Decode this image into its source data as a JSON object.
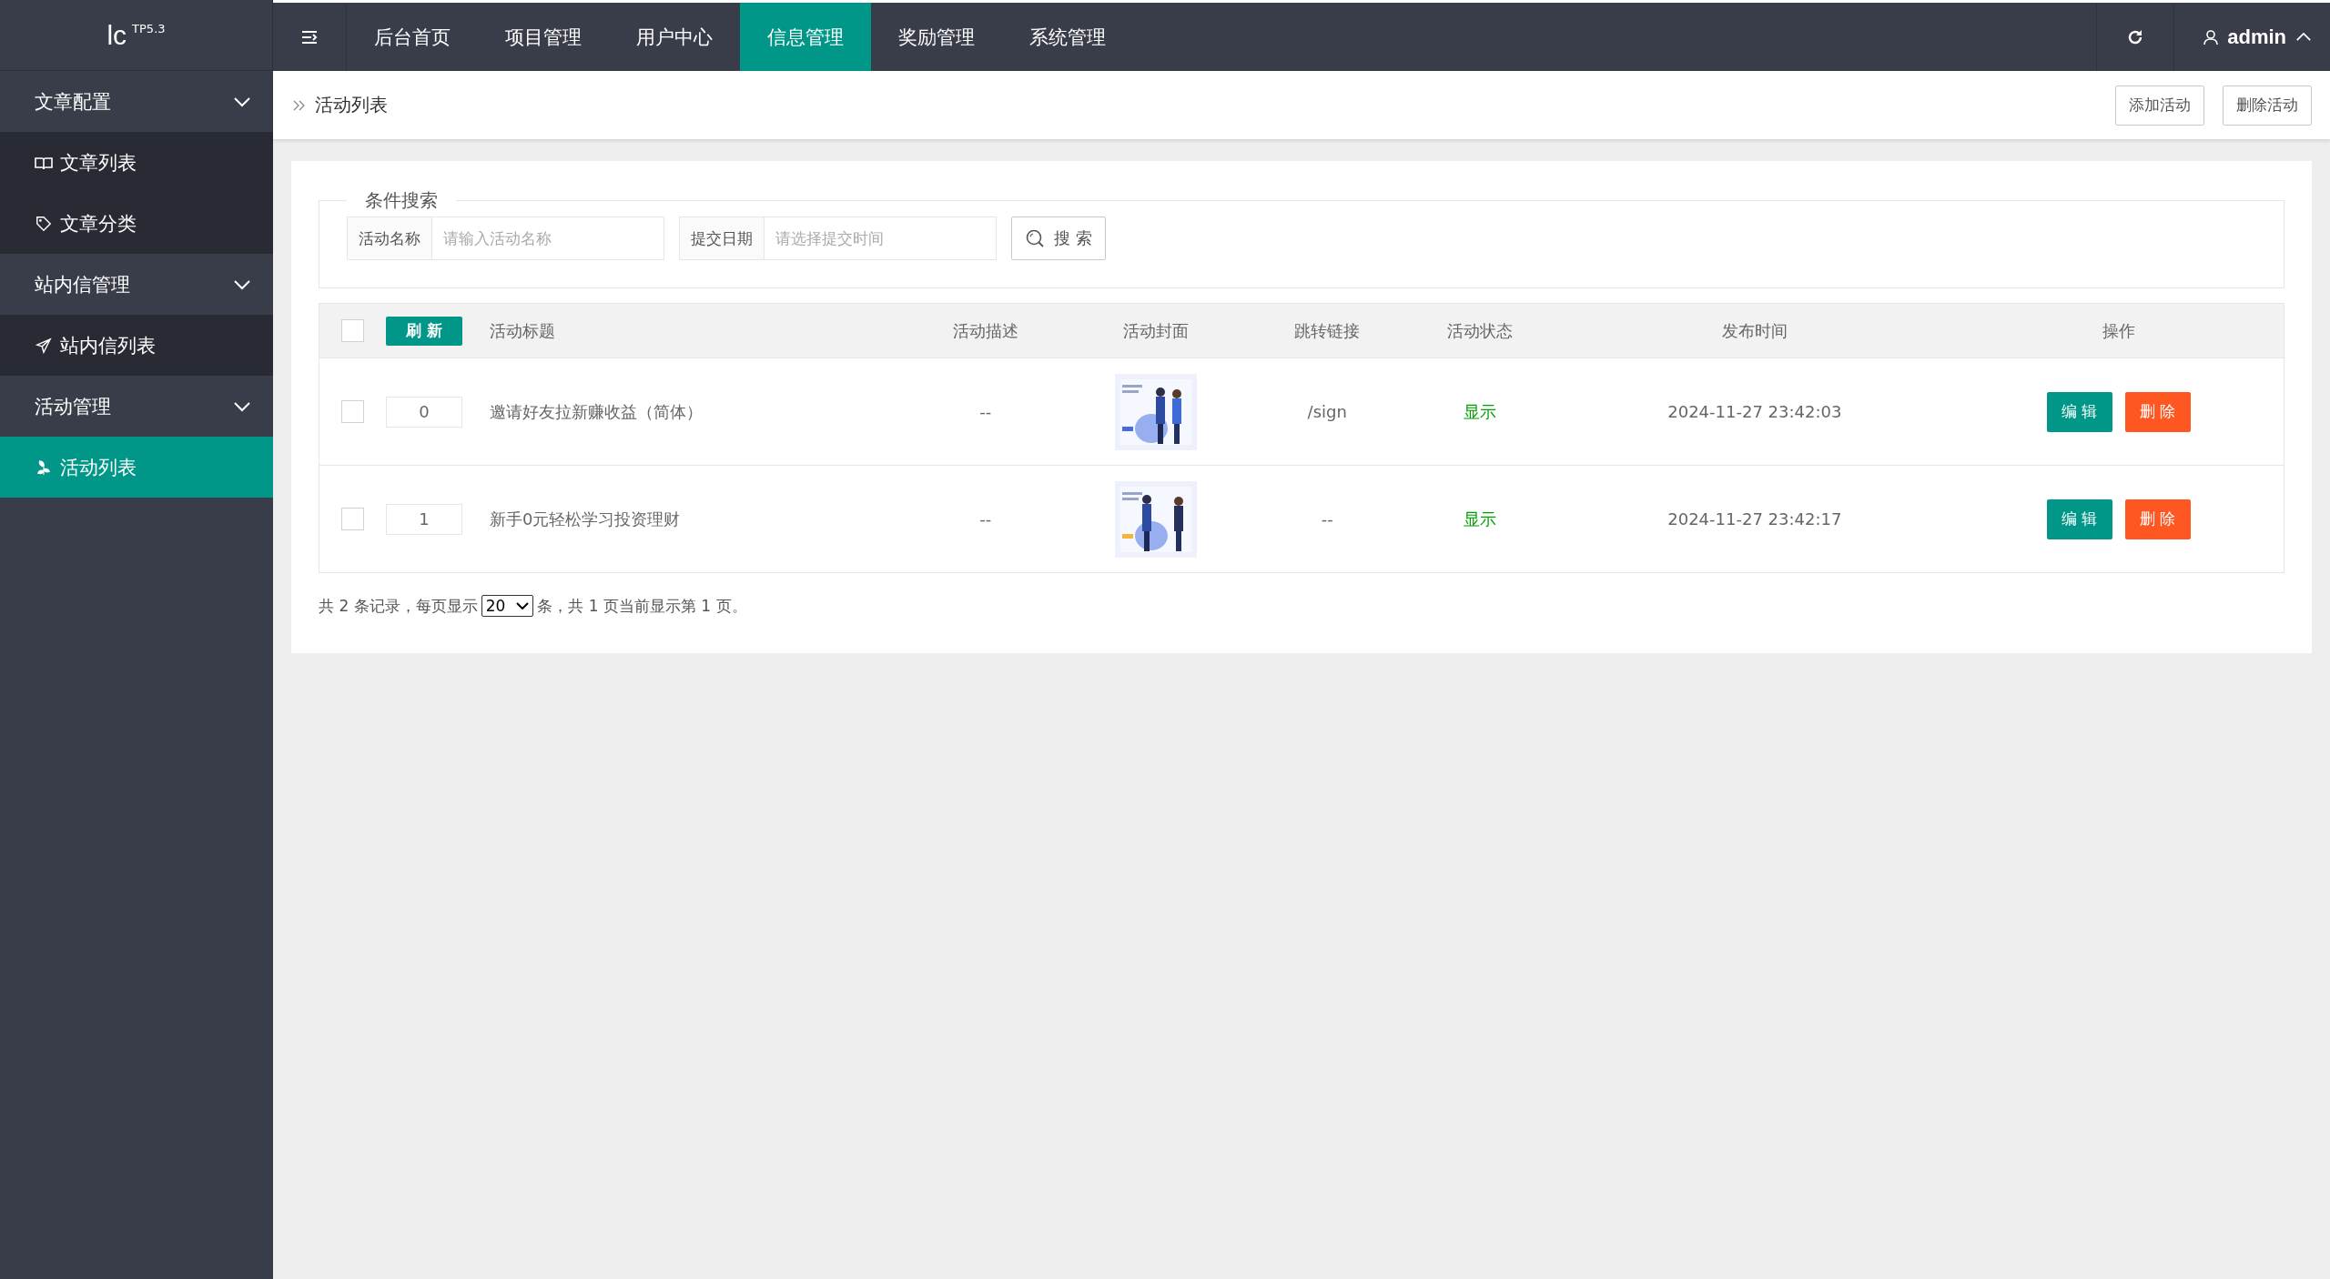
{
  "logo": {
    "text": "lc",
    "version": "TP5.3"
  },
  "top_nav": [
    {
      "label": "后台首页",
      "selected": false
    },
    {
      "label": "项目管理",
      "selected": false
    },
    {
      "label": "用户中心",
      "selected": false
    },
    {
      "label": "信息管理",
      "selected": true
    },
    {
      "label": "奖励管理",
      "selected": false
    },
    {
      "label": "系统管理",
      "selected": false
    }
  ],
  "user": {
    "name": "admin",
    "expanded": true
  },
  "sidebar": [
    {
      "label": "文章配置",
      "expanded": true,
      "children": [
        {
          "label": "文章列表",
          "selected": false
        },
        {
          "label": "文章分类",
          "selected": false
        }
      ]
    },
    {
      "label": "站内信管理",
      "expanded": true,
      "children": [
        {
          "label": "站内信列表",
          "selected": false
        }
      ]
    },
    {
      "label": "活动管理",
      "expanded": true,
      "children": [
        {
          "label": "活动列表",
          "selected": true
        }
      ]
    }
  ],
  "breadcrumb": "活动列表",
  "header_buttons": [
    "添加活动",
    "删除活动"
  ],
  "search": {
    "legend": "条件搜索",
    "fields": [
      {
        "label": "活动名称",
        "placeholder": "请输入活动名称"
      },
      {
        "label": "提交日期",
        "placeholder": "请选择提交时间"
      }
    ],
    "button": "搜 索"
  },
  "table": {
    "select_all_checked": false,
    "refresh_button": "刷 新",
    "columns": [
      "活动标题",
      "活动描述",
      "活动封面",
      "跳转链接",
      "活动状态",
      "发布时间",
      "操作"
    ],
    "rows": [
      {
        "checked": false,
        "sort": "0",
        "title": "邀请好友拉新赚收益（简体）",
        "description": "--",
        "cover": {
          "kind": "picture"
        },
        "link": "/sign",
        "status": "显示",
        "time": "2024-11-27 23:42:03",
        "actions": [
          "编 辑",
          "删 除"
        ]
      },
      {
        "checked": false,
        "sort": "1",
        "title": "新手0元轻松学习投资理财",
        "description": "--",
        "cover": {
          "kind": "picture"
        },
        "link": "--",
        "status": "显示",
        "time": "2024-11-27 23:42:17",
        "actions": [
          "编 辑",
          "删 除"
        ]
      }
    ]
  },
  "pagination": {
    "before": "共 2 条记录，每页显示",
    "page_size": "20",
    "after": "条，共 1 页当前显示第 1 页。"
  }
}
